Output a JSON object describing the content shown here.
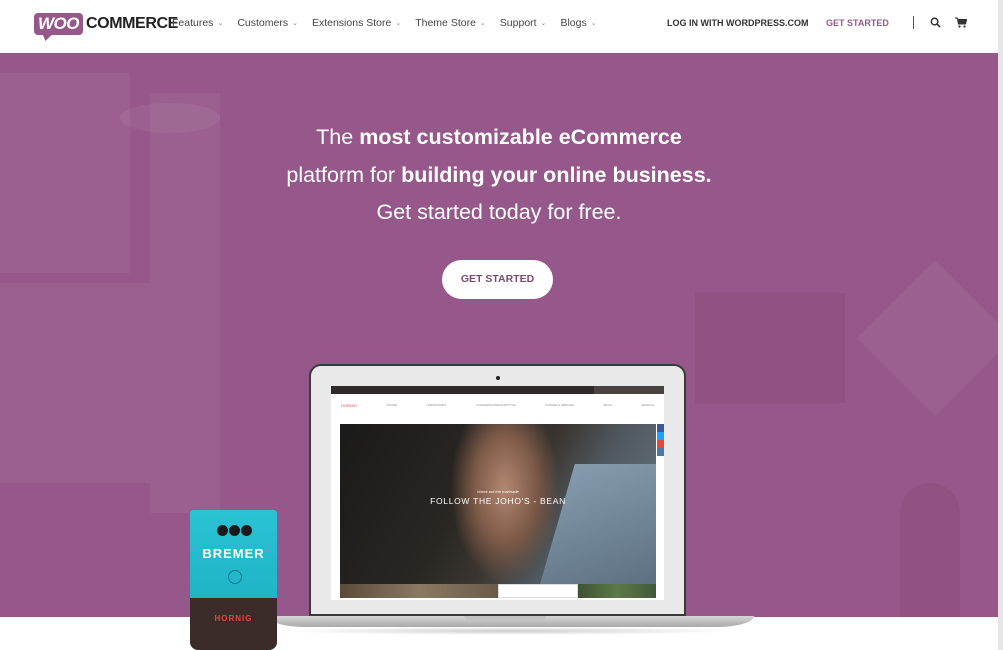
{
  "header": {
    "logo": {
      "woo": "WOO",
      "commerce": "COMMERCE"
    },
    "nav": [
      {
        "label": "Features"
      },
      {
        "label": "Customers"
      },
      {
        "label": "Extensions Store"
      },
      {
        "label": "Theme Store"
      },
      {
        "label": "Support"
      },
      {
        "label": "Blogs"
      }
    ],
    "nav_chevron": "⌄",
    "login_label": "LOG IN WITH WORDPRESS.COM",
    "get_started_label": "GET STARTED",
    "icons": [
      "search-icon",
      "cart-icon"
    ]
  },
  "hero": {
    "line1_pre": "The ",
    "line1_bold": "most customizable eCommerce",
    "line2_pre": "platform for ",
    "line2_bold": "building your online business.",
    "line3": "Get started today for free.",
    "cta_label": "GET STARTED",
    "brand_color": "#96588a"
  },
  "laptop_screen": {
    "brand": "HORNIG",
    "nav": [
      "STORE",
      "LABORATORY",
      "COFFEEHOUSE/LIFESTYLE",
      "COFFEE & SERVICE",
      "BLOG",
      "SEARCH"
    ],
    "script_text": "check out the marinade",
    "headline": "FOLLOW THE JOHO'S - BEAN",
    "social_colors": [
      "#3b5998",
      "#1da1f2",
      "#dd4b39",
      "#4a76a8"
    ]
  },
  "product": {
    "brand": "BREMER",
    "maker": "HORNIG"
  }
}
